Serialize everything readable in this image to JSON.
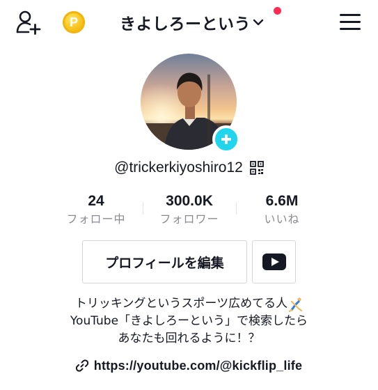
{
  "header": {
    "title": "きよしろーという",
    "icons": {
      "add_user": "add-user-icon",
      "coin": "coin-icon",
      "chevron": "chevron-down-icon",
      "menu": "hamburger-menu-icon"
    },
    "coin_glyph": "P"
  },
  "profile": {
    "handle": "@trickerkiyoshiro12",
    "stats": [
      {
        "value": "24",
        "label": "フォロー中"
      },
      {
        "value": "300.0K",
        "label": "フォロワー"
      },
      {
        "value": "6.6M",
        "label": "いいね"
      }
    ],
    "edit_button_label": "プロフィールを編集",
    "bio_lines": [
      "トリッキングというスポーツ広めてる人",
      "YouTube「きよしろーという」で検索したら",
      "あなたも回れるように！？"
    ],
    "bio_emoji": "gymnast-cartwheel-emoji",
    "link": "https://youtube.com/@kickflip_life"
  },
  "colors": {
    "accent_cyan": "#20d5ec",
    "notification_red": "#fe2c55",
    "text_primary": "#161823",
    "text_secondary": "#8a8b91",
    "coin_gold": "#f7c21b"
  }
}
